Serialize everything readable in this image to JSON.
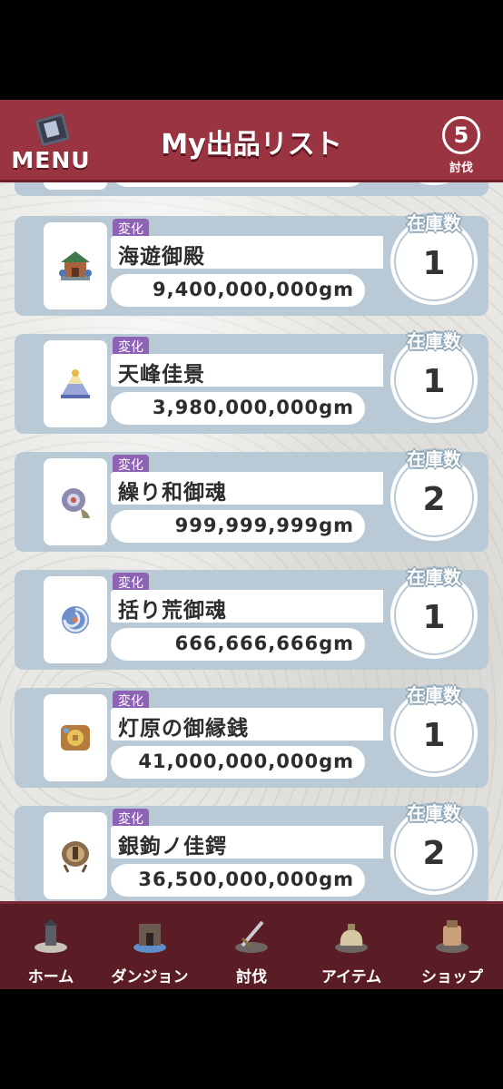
{
  "header": {
    "menu_label": "MENU",
    "title": "My出品リスト",
    "count_value": "5",
    "count_label": "討伐"
  },
  "listings": [
    {
      "tag": "変化",
      "name": "海遊御殿",
      "price": "9,400,000,000gm",
      "stock_label": "在庫数",
      "stock": "1",
      "icon": "shrine-icon"
    },
    {
      "tag": "変化",
      "name": "天峰佳景",
      "price": "3,980,000,000gm",
      "stock_label": "在庫数",
      "stock": "1",
      "icon": "mountain-icon"
    },
    {
      "tag": "変化",
      "name": "繰り和御魂",
      "price": "999,999,999gm",
      "stock_label": "在庫数",
      "stock": "2",
      "icon": "spirit-orb-icon"
    },
    {
      "tag": "変化",
      "name": "括り荒御魂",
      "price": "666,666,666gm",
      "stock_label": "在庫数",
      "stock": "1",
      "icon": "swirl-orb-icon"
    },
    {
      "tag": "変化",
      "name": "灯原の御縁銭",
      "price": "41,000,000,000gm",
      "stock_label": "在庫数",
      "stock": "1",
      "icon": "coin-icon"
    },
    {
      "tag": "変化",
      "name": "銀鉤ノ佳鍔",
      "price": "36,500,000,000gm",
      "stock_label": "在庫数",
      "stock": "2",
      "icon": "tsuba-icon"
    }
  ],
  "bottom_nav": [
    {
      "label": "ホーム",
      "icon": "home-icon"
    },
    {
      "label": "ダンジョン",
      "icon": "dungeon-icon"
    },
    {
      "label": "討伐",
      "icon": "sword-icon"
    },
    {
      "label": "アイテム",
      "icon": "item-bag-icon"
    },
    {
      "label": "ショップ",
      "icon": "shop-bag-icon"
    }
  ],
  "colors": {
    "header": "#9a3441",
    "bottom_nav": "#5b1d25",
    "card": "#b9cad6",
    "tag": "#8e63b6"
  }
}
